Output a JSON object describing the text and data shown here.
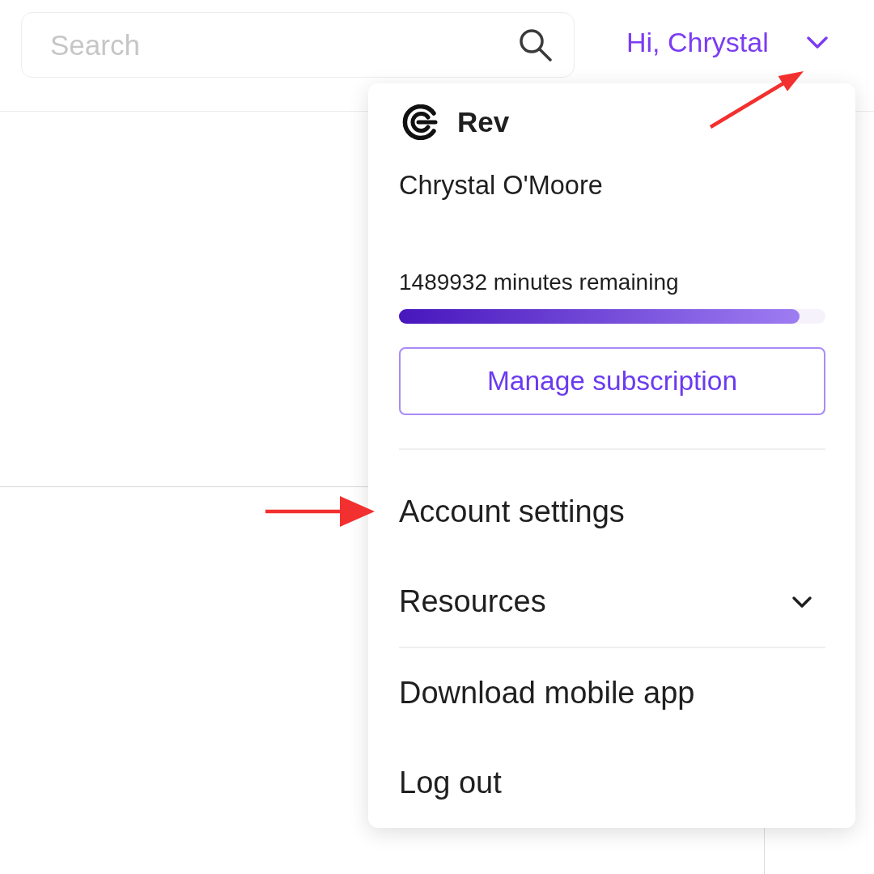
{
  "header": {
    "search": {
      "placeholder": "Search"
    },
    "user_menu": {
      "greeting": "Hi, Chrystal",
      "expanded": true
    }
  },
  "dropdown": {
    "brand": "Rev",
    "user_name": "Chrystal O'Moore",
    "usage": {
      "label": "1489932 minutes remaining",
      "level": 0.94
    },
    "manage_button": "Manage subscription",
    "item_groups": [
      [
        {
          "label": "Account settings",
          "kind": "link"
        },
        {
          "label": "Resources",
          "kind": "submenu",
          "expanded": false
        }
      ],
      [
        {
          "label": "Download mobile app",
          "kind": "link"
        },
        {
          "label": "Log out",
          "kind": "link"
        }
      ]
    ]
  },
  "annotations": [
    {
      "kind": "arrow"
    },
    {
      "kind": "arrow"
    }
  ]
}
